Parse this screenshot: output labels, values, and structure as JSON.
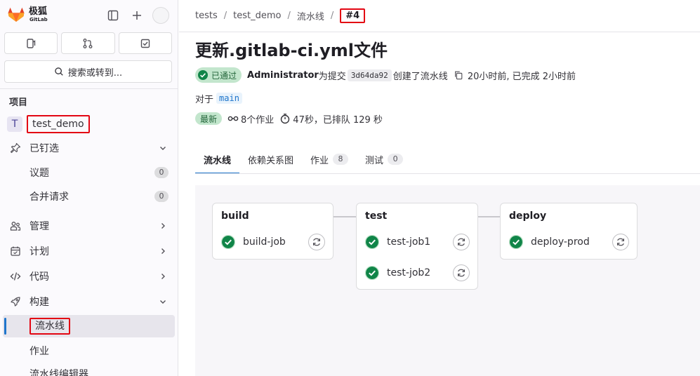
{
  "brand": {
    "name_cn": "极狐",
    "name_en": "GitLab"
  },
  "sidebar": {
    "search_label": "搜索或转到...",
    "section_label": "项目",
    "project": {
      "avatar_letter": "T",
      "name": "test_demo"
    },
    "items": [
      {
        "label": "已钉选"
      },
      {
        "label": "议题",
        "count": "0"
      },
      {
        "label": "合并请求",
        "count": "0"
      },
      {
        "label": "管理"
      },
      {
        "label": "计划"
      },
      {
        "label": "代码"
      },
      {
        "label": "构建"
      },
      {
        "label": "流水线"
      },
      {
        "label": "作业"
      },
      {
        "label": "流水线编辑器"
      }
    ]
  },
  "breadcrumb": [
    "tests",
    "test_demo",
    "流水线",
    "#4"
  ],
  "pipeline": {
    "title": "更新.gitlab-ci.yml文件",
    "status": "已通过",
    "author": "Administrator",
    "text_for_commit": "为提交",
    "commit_sha": "3d64da92",
    "text_created": "创建了流水线",
    "time_info": "20小时前, 已完成 2小时前",
    "ref_prefix": "对于",
    "ref": "main",
    "latest_badge": "最新",
    "jobs_count": "8个作业",
    "duration": "47秒，已排队 129 秒"
  },
  "tabs": [
    {
      "label": "流水线"
    },
    {
      "label": "依赖关系图"
    },
    {
      "label": "作业",
      "count": "8"
    },
    {
      "label": "测试",
      "count": "0"
    }
  ],
  "stages": [
    {
      "name": "build",
      "jobs": [
        "build-job"
      ]
    },
    {
      "name": "test",
      "jobs": [
        "test-job1",
        "test-job2"
      ]
    },
    {
      "name": "deploy",
      "jobs": [
        "deploy-prod"
      ]
    }
  ],
  "colors": {
    "success": "#108548",
    "accent": "#1f75cb",
    "highlight": "#e30613"
  }
}
